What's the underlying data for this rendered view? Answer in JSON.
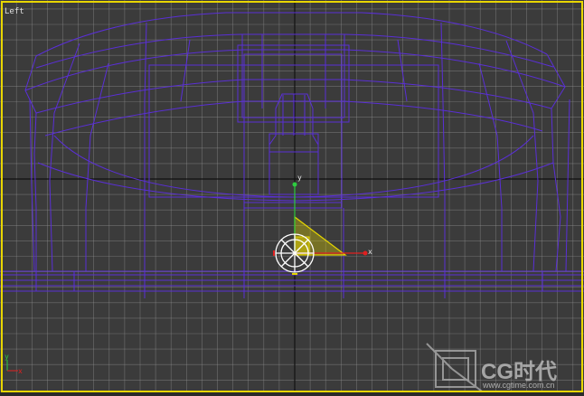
{
  "viewport": {
    "label": "Left",
    "border_color": "#e8d600",
    "grid_color": "#9a9a9a",
    "background": "#3b3b3b",
    "wire_color": "#5a2fd6"
  },
  "gizmo": {
    "y_label": "y",
    "x_label": "x",
    "y_color": "#2ecc40",
    "x_color": "#e02020",
    "plane_color": "#e6d600"
  },
  "watermark": {
    "brand": "CG时代",
    "url": "www.cgtime.com.cn"
  },
  "icons": [
    "viewport-axis-tripod-icon",
    "watermark-logo-icon"
  ]
}
